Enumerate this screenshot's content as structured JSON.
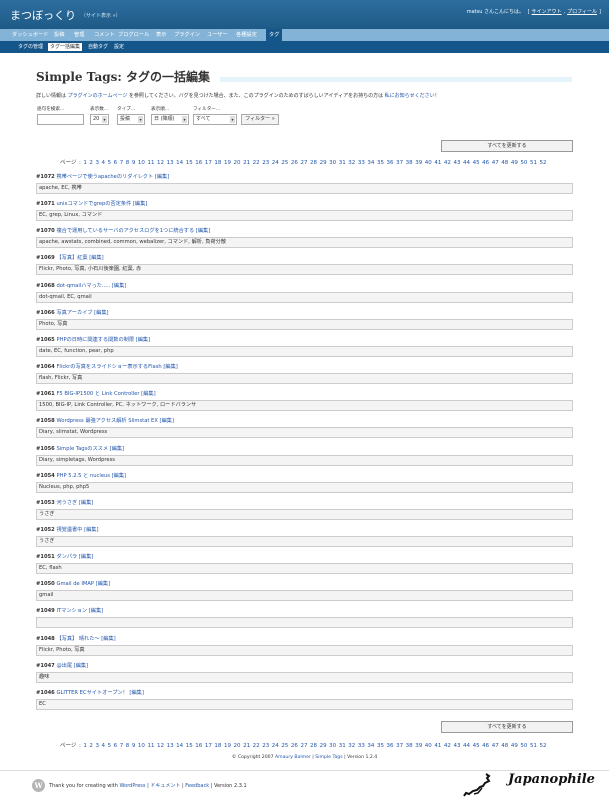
{
  "header": {
    "blog_title": "まつぼっくり",
    "view_site": "（サイト表示 »）",
    "greeting": "matsu さんこんにちは。",
    "sign_out": "サインアウト",
    "profile": "プロフィール"
  },
  "menu": [
    "ダッシュボード",
    "投稿",
    "管理",
    "コメント",
    "ブログロール",
    "表示",
    "プラグイン",
    "ユーザー",
    "各種設定",
    "タグ"
  ],
  "submenu": [
    "タグの管理",
    "タグ一括編集",
    "自動タグ",
    "設定"
  ],
  "page": {
    "title": "Simple Tags: タグの一括編集",
    "intro_prefix": "詳しい情報は",
    "intro_link": "プラグインのホームページ",
    "intro_middle": "を参照してください。バグを見つけた場合、また、このプラグインのためのすばらしいアイディアをお持ちの方は",
    "intro_link2": "私にお知らせください！"
  },
  "filter": {
    "search_label": "語句を検索...",
    "display_label": "表示数...",
    "type_label": "タイプ...",
    "order_label": "表示順...",
    "filter_label": "フィルター...",
    "display_value": "20",
    "type_value": "投稿",
    "order_value": "日 (降順)",
    "filter_value": "すべて",
    "filter_button": "フィルター »"
  },
  "update_all_label": "すべてを更新する",
  "pager_prefix": "ページ :",
  "pages": [
    "1",
    "2",
    "3",
    "4",
    "5",
    "6",
    "7",
    "8",
    "9",
    "10",
    "11",
    "12",
    "13",
    "14",
    "15",
    "16",
    "17",
    "18",
    "19",
    "20",
    "21",
    "22",
    "23",
    "24",
    "25",
    "26",
    "27",
    "28",
    "29",
    "30",
    "31",
    "32",
    "33",
    "34",
    "35",
    "36",
    "37",
    "38",
    "39",
    "40",
    "41",
    "42",
    "43",
    "44",
    "45",
    "46",
    "47",
    "48",
    "49",
    "50",
    "51",
    "52"
  ],
  "edit_label": "[編集]",
  "posts": [
    {
      "id": "#1072",
      "title": "携帯ページで使うapacheのリダイレクト",
      "tags": "apache, EC, 携帯"
    },
    {
      "id": "#1071",
      "title": "unixコマンドでgrepの否定条件",
      "tags": "EC, grep, Linux, コマンド"
    },
    {
      "id": "#1070",
      "title": "複合で運用しているサーバのアクセスログを1つに統合する",
      "tags": "apache, awstats, combined, common, webalizer, コマンド, 解析, 負荷分散"
    },
    {
      "id": "#1069",
      "title": "【写真】紅葉",
      "tags": "Flickr, Photo, 写真, 小石川後楽園, 紅葉, 赤"
    },
    {
      "id": "#1068",
      "title": "dot-qmailハマった.....",
      "tags": "dot-qmail, EC, qmail"
    },
    {
      "id": "#1066",
      "title": "写真アーカイブ",
      "tags": "Photo, 写真"
    },
    {
      "id": "#1065",
      "title": "PHPの日時に関連する関数の制限",
      "tags": "date, EC, function, pear, php"
    },
    {
      "id": "#1064",
      "title": "Flickrの写真をスライドショー表示するFlash",
      "tags": "flash, Flickr, 写真"
    },
    {
      "id": "#1061",
      "title": "F5 BIG-IP1500 と Link Controller",
      "tags": "1500, BIG-IP, Link Controller, PC, ネットワーク, ロードバランサ"
    },
    {
      "id": "#1058",
      "title": "Wordpress 最強アクセス解析 Slimstat EX",
      "tags": "Diary, slimstat, Wordpress"
    },
    {
      "id": "#1056",
      "title": "Simple Tagsのススメ",
      "tags": "Diary, simpletags, Wordpress"
    },
    {
      "id": "#1054",
      "title": "PHP 5.2.5 と nucleus",
      "tags": "Nucleus, php, php5"
    },
    {
      "id": "#1053",
      "title": "河うさぎ",
      "tags": "うさぎ"
    },
    {
      "id": "#1052",
      "title": "視覚遺書中",
      "tags": "うさぎ"
    },
    {
      "id": "#1051",
      "title": "ダンパラ",
      "tags": "EC, flash"
    },
    {
      "id": "#1050",
      "title": "Gmail de IMAP",
      "tags": "gmail"
    },
    {
      "id": "#1049",
      "title": "ITマンション",
      "tags": ""
    },
    {
      "id": "#1048",
      "title": "【写真】 晴れた～",
      "tags": "Flickr, Photo, 写真"
    },
    {
      "id": "#1047",
      "title": "@出尾",
      "tags": "趣味"
    },
    {
      "id": "#1046",
      "title": "GLITTER ECサイトオープン！",
      "tags": "EC"
    }
  ],
  "copyright": {
    "prefix": "© Copyright 2007",
    "author": "Amaury Balmer",
    "plugin": "Simple Tags",
    "version": "Version 1.2.4"
  },
  "footer": {
    "thanks": "Thank you for creating with",
    "wordpress": "WordPress",
    "docs": "ドキュメント",
    "feedback": "Feedback",
    "version": "Version 2.3.1",
    "logo_letter": "W"
  },
  "watermark": "Japanophile"
}
